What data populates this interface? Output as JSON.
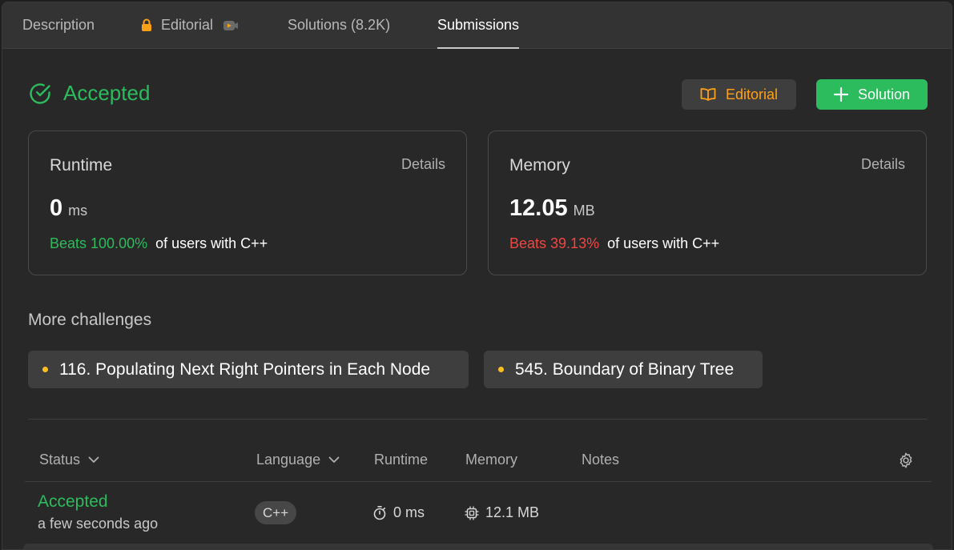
{
  "tabs": {
    "description": "Description",
    "editorial": "Editorial",
    "solutions": "Solutions (8.2K)",
    "submissions": "Submissions"
  },
  "result": {
    "status": "Accepted",
    "editorial_button": "Editorial",
    "solution_button": "Solution"
  },
  "runtime_card": {
    "title": "Runtime",
    "details": "Details",
    "value": "0",
    "unit": "ms",
    "beats": "Beats 100.00%",
    "beats_suffix": "of users with C++"
  },
  "memory_card": {
    "title": "Memory",
    "details": "Details",
    "value": "12.05",
    "unit": "MB",
    "beats": "Beats 39.13%",
    "beats_suffix": "of users with C++"
  },
  "challenges": {
    "title": "More challenges",
    "items": [
      "116. Populating Next Right Pointers in Each Node",
      "545. Boundary of Binary Tree"
    ]
  },
  "table": {
    "headers": {
      "status": "Status",
      "language": "Language",
      "runtime": "Runtime",
      "memory": "Memory",
      "notes": "Notes"
    },
    "rows": [
      {
        "status": "Accepted",
        "time": "a few seconds ago",
        "language": "C++",
        "runtime": "0 ms",
        "memory": "12.1 MB"
      }
    ]
  },
  "colors": {
    "accent_green": "#2cbb5d",
    "accent_orange": "#ffa116",
    "accent_red": "#ef4743",
    "difficulty_dot": "#ffc01e"
  },
  "icons": {
    "lock": "lock-icon",
    "video": "video-icon",
    "check": "check-circle-icon",
    "book": "book-open-icon",
    "plus": "plus-icon",
    "chevron": "chevron-down-icon",
    "gear": "gear-icon",
    "timer": "timer-icon",
    "chip": "memory-chip-icon"
  }
}
